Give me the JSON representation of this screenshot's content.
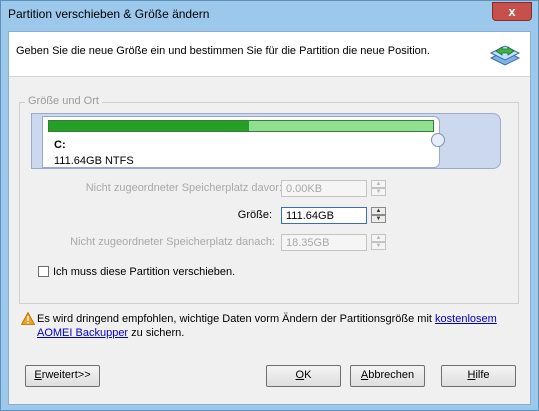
{
  "window": {
    "title": "Partition verschieben & Größe ändern",
    "close_glyph": "x"
  },
  "header": {
    "instruction": "Geben Sie die neue Größe ein und bestimmen Sie für die Partition die neue Position.",
    "icon": "resize-arrows-icon"
  },
  "group": {
    "title": "Größe und Ort"
  },
  "partition": {
    "letter": "C:",
    "info": "111.64GB NTFS",
    "used_fraction": 0.52
  },
  "fields": {
    "before": {
      "label": "Nicht zugeordneter Speicherplatz davor:",
      "value": "0.00KB"
    },
    "size": {
      "label": "Größe:",
      "value": "111.64GB"
    },
    "after": {
      "label": "Nicht zugeordneter Speicherplatz danach:",
      "value": "18.35GB"
    }
  },
  "checkbox": {
    "label": "Ich muss diese Partition verschieben."
  },
  "warning": {
    "text_before": "Es wird dringend empfohlen, wichtige Daten vorm Ändern der Partitionsgröße mit ",
    "link": "kostenlosem AOMEI Backupper",
    "text_after": " zu sichern."
  },
  "buttons": {
    "advanced": {
      "mnemonic": "E",
      "rest": "rweitert>>"
    },
    "ok": {
      "mnemonic": "O",
      "rest": "K"
    },
    "cancel": {
      "mnemonic": "A",
      "rest": "bbrechen"
    },
    "help": {
      "mnemonic": "H",
      "rest": "ilfe"
    }
  },
  "colors": {
    "bar_fill": "#24a124",
    "bar_track": "#8fe08f",
    "link": "#0000cc",
    "warning": "#f0a020"
  }
}
